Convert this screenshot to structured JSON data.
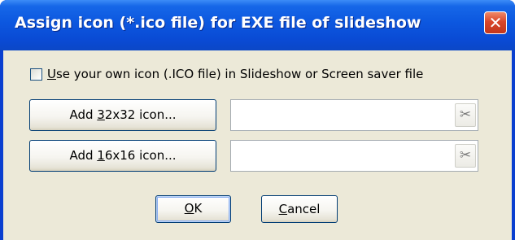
{
  "window": {
    "title": "Assign icon (*.ico file) for EXE file of slideshow",
    "close_glyph": "✕"
  },
  "checkbox": {
    "checked": false,
    "label_mnemonic": "U",
    "label_rest": "se your own icon (.ICO file) in Slideshow or Screen saver file"
  },
  "buttons": {
    "add32": {
      "pre": "Add ",
      "mnemonic": "3",
      "post": "2x32 icon..."
    },
    "add16": {
      "pre": "Add ",
      "mnemonic": "1",
      "post": "6x16 icon..."
    },
    "ok": {
      "mnemonic": "O",
      "post": "K"
    },
    "cancel": {
      "mnemonic": "C",
      "post": "ancel"
    }
  },
  "fields": {
    "icon32": {
      "value": "",
      "clear_icon": "scissors-icon",
      "clear_glyph": "✂"
    },
    "icon16": {
      "value": "",
      "clear_icon": "scissors-icon",
      "clear_glyph": "✂"
    }
  },
  "colors": {
    "titlebar": "#0a4ad4",
    "client": "#ece9d8",
    "close": "#d9462a"
  }
}
